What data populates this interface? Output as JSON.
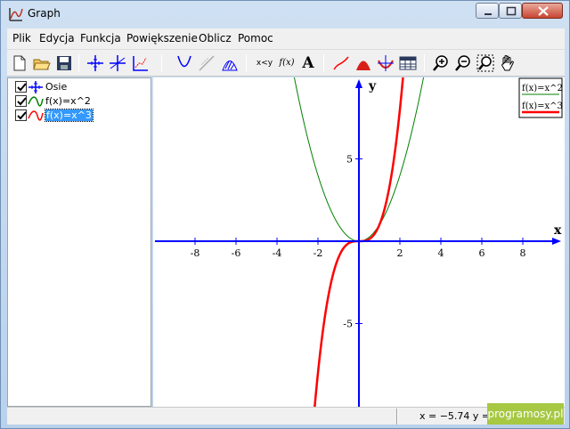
{
  "window": {
    "title": "Graph"
  },
  "menu": [
    "Plik",
    "Edycja",
    "Funkcja",
    "Powiększenie",
    "Oblicz",
    "Pomoc"
  ],
  "toolbar": {
    "buttons": [
      "new-file-icon",
      "open-folder-icon",
      "save-icon",
      "insert-axes-icon",
      "insert-grid-icon",
      "insert-points-icon",
      "insert-function-icon",
      "insert-tangent-icon",
      "insert-shading-icon",
      "xy-label",
      "fx-label",
      "text-icon",
      "trendline-icon",
      "area-icon",
      "evaluate-icon",
      "table-icon",
      "zoom-in-icon",
      "zoom-out-icon",
      "zoom-window-icon",
      "pan-hand-icon"
    ],
    "xy_label": "x<y",
    "fx_label": "f(x)",
    "text_label": "A"
  },
  "sidebar": {
    "items": [
      {
        "label": "Osie",
        "icon": "axes-icon",
        "checked": true,
        "color": "#0000ff"
      },
      {
        "label": "f(x)=x^2",
        "icon": "curve-icon",
        "checked": true,
        "color": "#008000"
      },
      {
        "label": "f(x)=x^3",
        "icon": "curve-icon",
        "checked": true,
        "color": "#ff0000",
        "selected": true
      }
    ]
  },
  "status": {
    "text": "x = −5.74   y = "
  },
  "watermark": "programosy.pl",
  "colors": {
    "axes": "#0000ff",
    "square": "#008000",
    "cube": "#ff0000",
    "selection": "#3399ff"
  },
  "chart_data": {
    "type": "line",
    "title": "",
    "xlabel": "x",
    "ylabel": "y",
    "xlim": [
      -10,
      10
    ],
    "ylim": [
      -10,
      10
    ],
    "x_ticks": [
      -8,
      -6,
      -4,
      -2,
      2,
      4,
      6,
      8
    ],
    "y_ticks": [
      -5,
      5
    ],
    "grid": false,
    "legend": "top-right",
    "series": [
      {
        "name": "f(x)=x^2",
        "expr": "x^2",
        "color": "#008000",
        "x": [
          -3,
          -2,
          -1,
          0,
          1,
          2,
          3
        ],
        "y": [
          9,
          4,
          1,
          0,
          1,
          4,
          9
        ]
      },
      {
        "name": "f(x)=x^3",
        "expr": "x^3",
        "color": "#ff0000",
        "x": [
          -2,
          -1,
          0,
          1,
          2
        ],
        "y": [
          -8,
          -1,
          0,
          1,
          8
        ]
      }
    ]
  }
}
